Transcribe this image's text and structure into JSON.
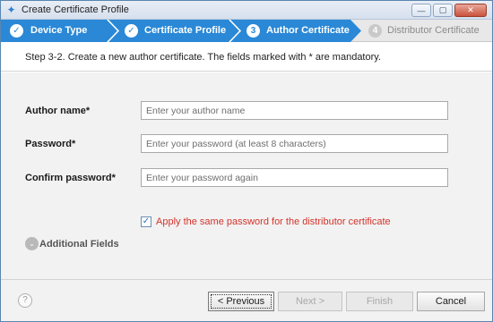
{
  "window": {
    "title": "Create Certificate Profile",
    "controls": {
      "minimize": "—",
      "maximize": "▢",
      "close": "✕"
    }
  },
  "steps": [
    {
      "label": "Device Type",
      "state": "completed",
      "marker": "✓"
    },
    {
      "label": "Certificate Profile",
      "state": "completed",
      "marker": "✓"
    },
    {
      "label": "Author Certificate",
      "state": "current",
      "marker": "3"
    },
    {
      "label": "Distributor Certificate",
      "state": "upcoming",
      "marker": "4"
    }
  ],
  "instruction": "Step 3-2. Create a new author certificate. The fields marked with * are mandatory.",
  "form": {
    "author_name": {
      "label": "Author name*",
      "placeholder": "Enter your author name",
      "value": ""
    },
    "password": {
      "label": "Password*",
      "placeholder": "Enter your password (at least 8 characters)",
      "value": ""
    },
    "confirm_password": {
      "label": "Confirm password*",
      "placeholder": "Enter your password again",
      "value": ""
    },
    "same_password_checkbox": {
      "label": "Apply the same password for the distributor certificate",
      "checked": true,
      "mark": "✓"
    },
    "additional_fields": {
      "label": "Additional Fields",
      "icon": "chevron-down-icon",
      "glyph": "⌄"
    }
  },
  "footer": {
    "help": "?",
    "previous": "< Previous",
    "next": "Next >",
    "finish": "Finish",
    "cancel": "Cancel"
  },
  "colors": {
    "step_active": "#2a88d6",
    "step_inactive": "#e8e8e8",
    "checkbox_label": "#d4332a"
  }
}
